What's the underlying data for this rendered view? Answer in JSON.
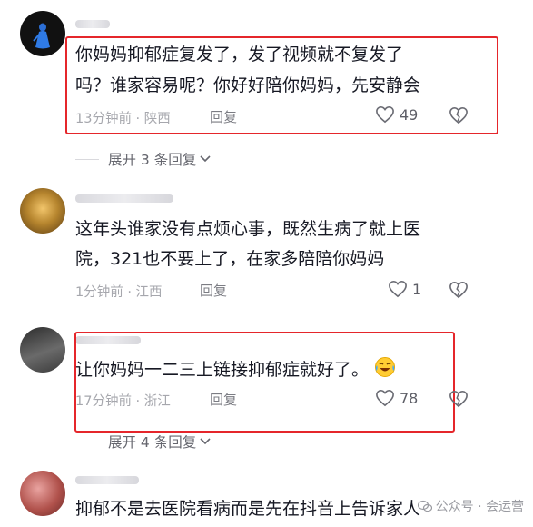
{
  "comments": [
    {
      "lines": [
        "你妈妈抑郁症复发了，发了视频就不复发了",
        "吗？谁家容易呢？你好好陪你妈妈，先安静会"
      ],
      "time_location": "13分钟前 · 陕西",
      "reply_label": "回复",
      "likes": "49",
      "highlighted": true
    },
    {
      "lines": [
        "这年头谁家没有点烦心事，既然生病了就上医",
        "院，321也不要上了，在家多陪陪你妈妈"
      ],
      "time_location": "1分钟前 · 江西",
      "reply_label": "回复",
      "likes": "1",
      "highlighted": false
    },
    {
      "lines": [
        "让你妈妈一二三上链接抑郁症就好了。"
      ],
      "time_location": "17分钟前 · 浙江",
      "reply_label": "回复",
      "likes": "78",
      "highlighted": true,
      "emoji": "laugh-cry-emoji"
    },
    {
      "lines": [
        "抑郁不是去医院看病而是先在抖音上告诉家人"
      ],
      "highlighted": false
    }
  ],
  "expand_1": "展开 3 条回复",
  "expand_2": "展开 4 条回复",
  "watermark": "公众号 · 会运营",
  "colors": {
    "highlight": "#e5262b",
    "meta": "#a6a7ad",
    "text": "#161823"
  }
}
